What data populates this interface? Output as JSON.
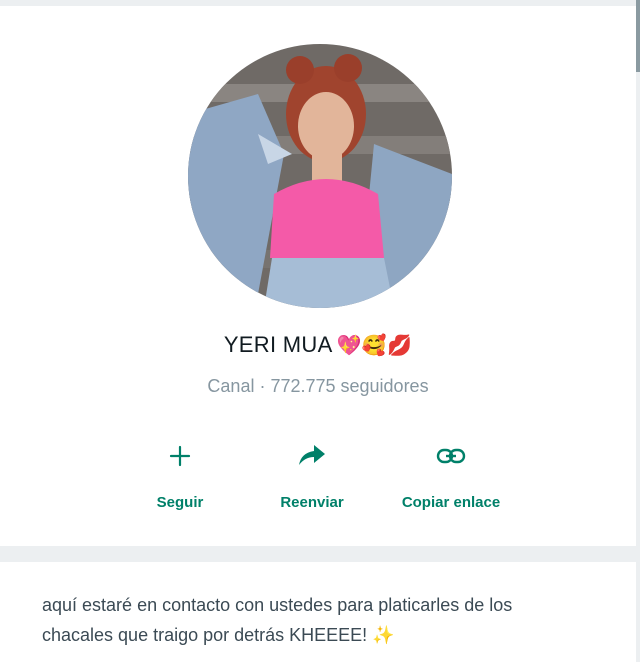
{
  "channel": {
    "name": "YERI MUA",
    "name_emojis": "💖🥰💋",
    "meta": "Canal · 772.775 seguidores"
  },
  "actions": [
    {
      "label": "Seguir",
      "icon": "plus-icon"
    },
    {
      "label": "Reenviar",
      "icon": "forward-arrow-icon"
    },
    {
      "label": "Copiar enlace",
      "icon": "link-icon"
    }
  ],
  "about": {
    "text": "aquí estaré en contacto con ustedes para platicarles de los chacales que traigo por detrás KHEEEE! ✨"
  },
  "colors": {
    "accent": "#008069",
    "background": "#eceff1",
    "text_primary": "#111b21",
    "text_secondary": "#8696a0"
  }
}
